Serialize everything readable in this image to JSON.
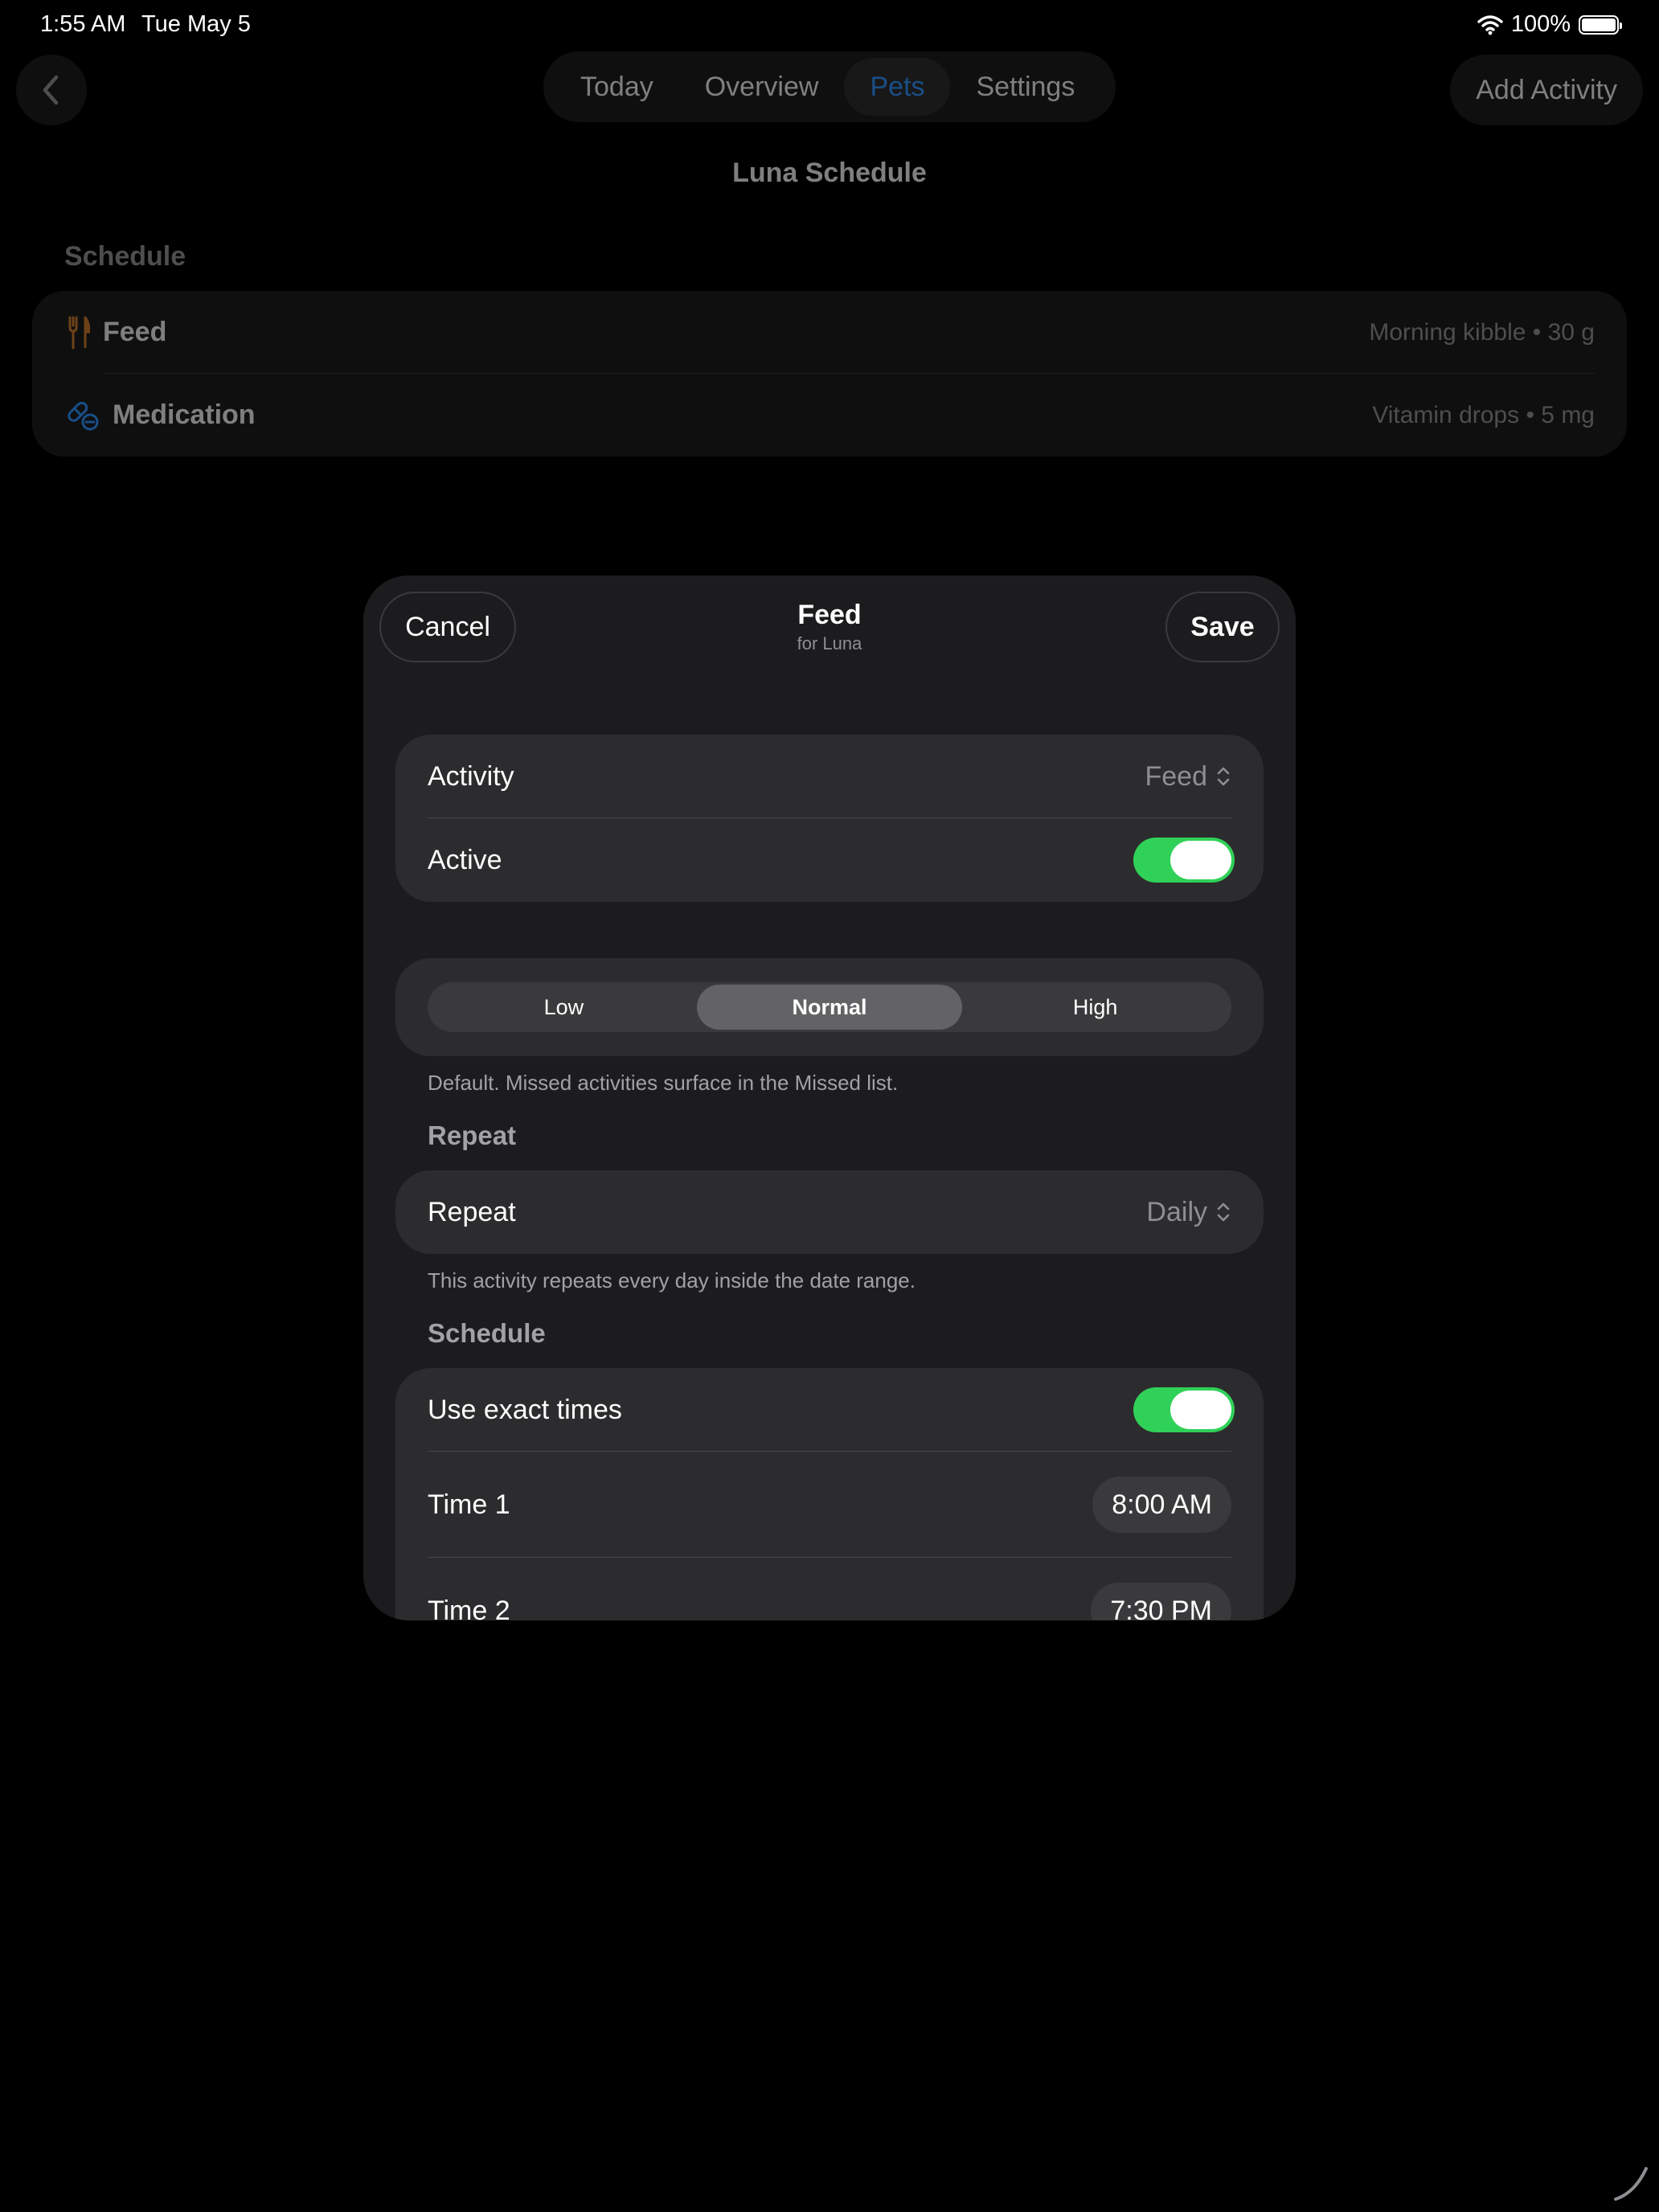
{
  "status_bar": {
    "time": "1:55 AM",
    "date": "Tue May 5",
    "battery": "100%"
  },
  "nav": {
    "tabs": [
      {
        "label": "Today"
      },
      {
        "label": "Overview"
      },
      {
        "label": "Pets",
        "selected": true
      },
      {
        "label": "Settings"
      }
    ],
    "add_activity": "Add Activity"
  },
  "page": {
    "title": "Luna Schedule",
    "section_header": "Schedule",
    "rows": [
      {
        "label": "Feed",
        "detail": "Morning kibble • 30 g",
        "icon": "fork-knife-icon"
      },
      {
        "label": "Medication",
        "detail": "Vitamin drops • 5 mg",
        "icon": "pills-icon"
      }
    ]
  },
  "sheet": {
    "cancel": "Cancel",
    "save": "Save",
    "title": "Feed",
    "subtitle": "for Luna",
    "activity_label": "Activity",
    "activity_value": "Feed",
    "active_label": "Active",
    "active_on": true,
    "priority_options": [
      "Low",
      "Normal",
      "High"
    ],
    "priority_selected": "Normal",
    "priority_note": "Default. Missed activities surface in the Missed list.",
    "repeat_header": "Repeat",
    "repeat_label": "Repeat",
    "repeat_value": "Daily",
    "repeat_note": "This activity repeats every day inside the date range.",
    "schedule_header": "Schedule",
    "exact_times_label": "Use exact times",
    "exact_times_on": true,
    "times": [
      {
        "label": "Time 1",
        "value": "8:00 AM"
      },
      {
        "label": "Time 2",
        "value": "7:30 PM"
      }
    ]
  },
  "colors": {
    "accent": "#2e8ef5",
    "toggle_on": "#30d158",
    "feed_icon": "#c8782a"
  }
}
